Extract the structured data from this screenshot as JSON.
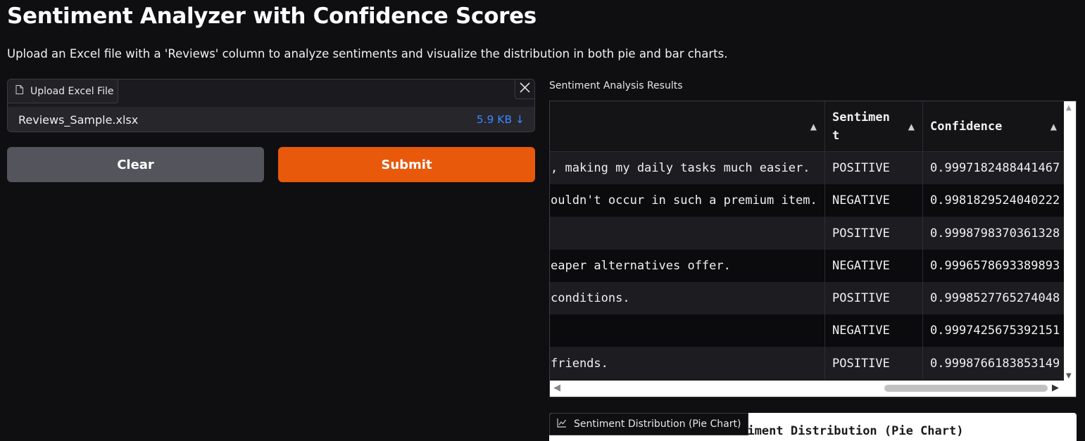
{
  "app": {
    "title": "Sentiment Analyzer with Confidence Scores",
    "description": "Upload an Excel file with a 'Reviews' column to analyze sentiments and visualize the distribution in both pie and bar charts."
  },
  "upload": {
    "label": "Upload Excel File",
    "label_icon": "file-icon",
    "close_icon": "close-icon",
    "file_name": "Reviews_Sample.xlsx",
    "file_size": "5.9 KB ↓"
  },
  "buttons": {
    "clear": "Clear",
    "submit": "Submit"
  },
  "results": {
    "label": "Sentiment Analysis Results",
    "columns": [
      "",
      "Sentiment",
      "Confidence"
    ],
    "sort_icon": "▲",
    "rows": [
      {
        "review": ", making my daily tasks much easier.",
        "sentiment": "POSITIVE",
        "confidence": "0.9997182488441467"
      },
      {
        "review": "ouldn't occur in such a premium item.",
        "sentiment": "NEGATIVE",
        "confidence": "0.9981829524040222"
      },
      {
        "review": "",
        "sentiment": "POSITIVE",
        "confidence": "0.9998798370361328"
      },
      {
        "review": "eaper alternatives offer.",
        "sentiment": "NEGATIVE",
        "confidence": "0.9996578693389893"
      },
      {
        "review": " conditions.",
        "sentiment": "POSITIVE",
        "confidence": "0.9998527765274048"
      },
      {
        "review": "",
        "sentiment": "NEGATIVE",
        "confidence": "0.9997425675392151"
      },
      {
        "review": "friends.",
        "sentiment": "POSITIVE",
        "confidence": "0.9998766183853149"
      }
    ]
  },
  "pie_chart": {
    "label": "Sentiment Distribution (Pie Chart)",
    "label_icon": "chart-icon",
    "title": "Sentiment Distribution (Pie Chart)"
  },
  "colors": {
    "background": "#0f0f11",
    "submit": "#e8590c",
    "clear": "#54545c",
    "file_size": "#3d86ff"
  }
}
